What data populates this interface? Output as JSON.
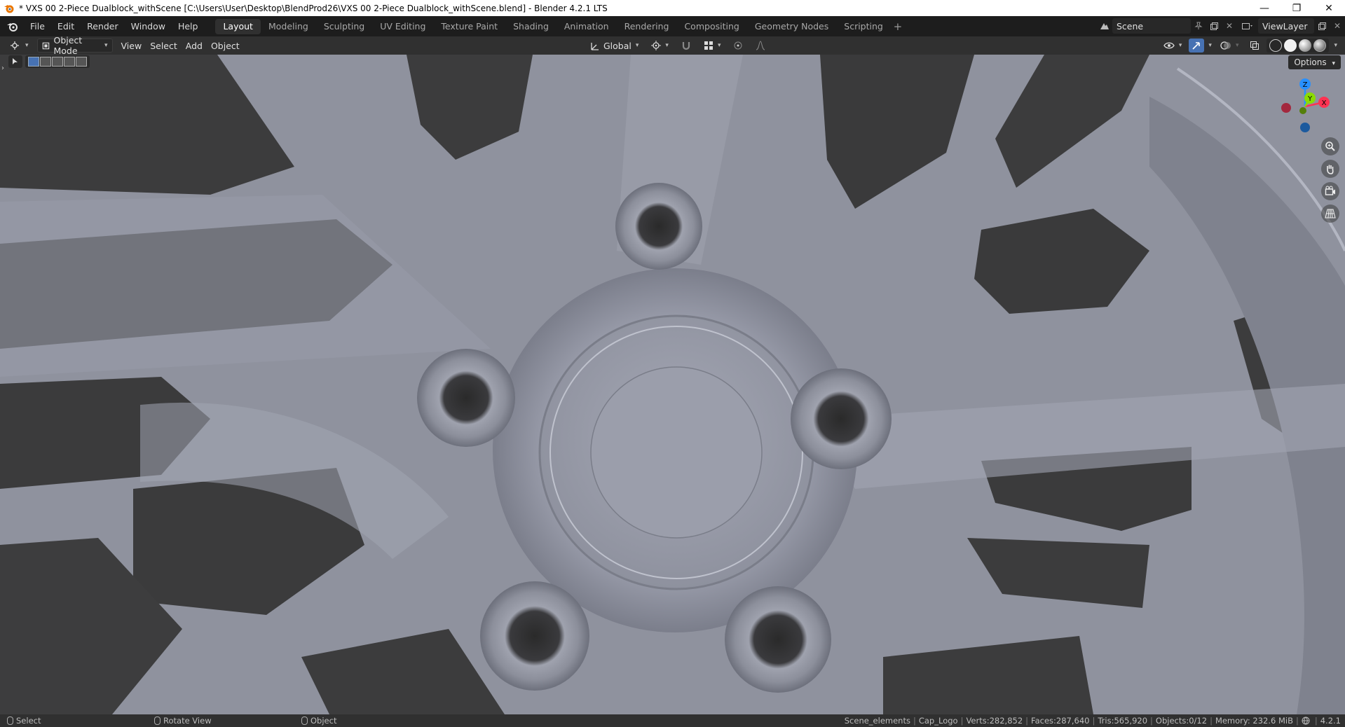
{
  "window": {
    "title": "* VXS 00 2-Piece Dualblock_withScene [C:\\Users\\User\\Desktop\\BlendProd26\\VXS 00 2-Piece Dualblock_withScene.blend] - Blender 4.2.1 LTS",
    "minimize": "—",
    "maximize": "❐",
    "close": "✕"
  },
  "menu": [
    "File",
    "Edit",
    "Render",
    "Window",
    "Help"
  ],
  "workspaces": [
    {
      "label": "Layout",
      "active": true
    },
    {
      "label": "Modeling"
    },
    {
      "label": "Sculpting"
    },
    {
      "label": "UV Editing"
    },
    {
      "label": "Texture Paint"
    },
    {
      "label": "Shading"
    },
    {
      "label": "Animation"
    },
    {
      "label": "Rendering"
    },
    {
      "label": "Compositing"
    },
    {
      "label": "Geometry Nodes"
    },
    {
      "label": "Scripting"
    }
  ],
  "workspace_add": "+",
  "scene": {
    "name": "Scene",
    "view_layer": "ViewLayer"
  },
  "viewport_header": {
    "mode": "Object Mode",
    "menus": [
      "View",
      "Select",
      "Add",
      "Object"
    ],
    "transform_orientation": "Global"
  },
  "options_label": "Options",
  "gizmo": {
    "z": "Z",
    "x": "X",
    "y": "Y"
  },
  "status": {
    "left": [
      {
        "label": "Select"
      },
      {
        "label": "Rotate View"
      },
      {
        "label": "Object"
      }
    ],
    "collection": "Scene_elements",
    "active_object": "Cap_Logo",
    "verts": "Verts:282,852",
    "faces": "Faces:287,640",
    "tris": "Tris:565,920",
    "objects": "Objects:0/12",
    "memory": "Memory: 232.6 MiB",
    "version": "4.2.1"
  },
  "colors": {
    "accent_blue": "#4772b3",
    "axis_x": "#ff3352",
    "axis_y": "#8bdc00",
    "axis_z": "#2890ff",
    "viewport_surface": "#9a9dab",
    "background": "#1d1d1d"
  }
}
